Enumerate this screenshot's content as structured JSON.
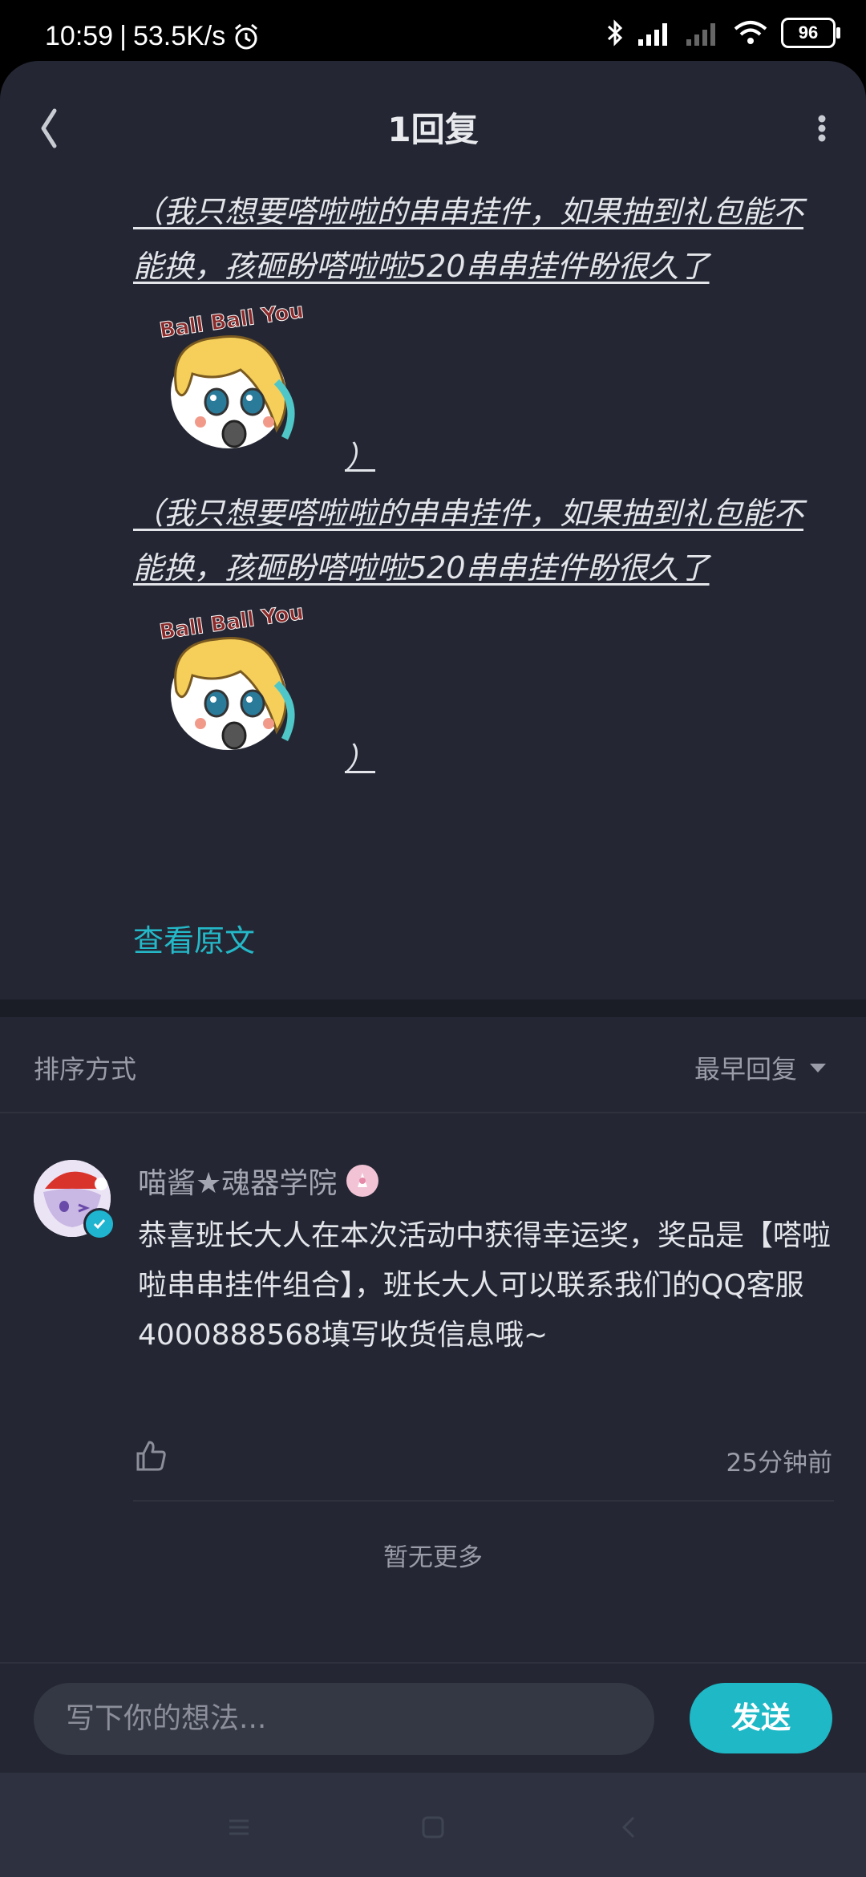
{
  "status_bar": {
    "time": "10:59",
    "speed": "53.5K/s",
    "battery": "96"
  },
  "header": {
    "title": "1回复"
  },
  "post": {
    "quote_1": "（我只想要嗒啦啦的串串挂件，如果抽到礼包能不能换，孩砸盼嗒啦啦520串串挂件盼很久了",
    "paren_1": "）",
    "quote_2": "（我只想要嗒啦啦的串串挂件，如果抽到礼包能不能换，孩砸盼嗒啦啦520串串挂件盼很久了",
    "paren_2": "）",
    "sticker_text": "Ball Ball You",
    "view_original": "查看原文"
  },
  "sort": {
    "label": "排序方式",
    "value": "最早回复"
  },
  "reply": {
    "name": "喵酱★魂器学院",
    "text": "恭喜班长大人在本次活动中获得幸运奖，奖品是【嗒啦啦串串挂件组合】，班长大人可以联系我们的QQ客服4000888568填写收货信息哦~",
    "time": "25分钟前"
  },
  "list_end": "暂无更多",
  "composer": {
    "placeholder": "写下你的想法...",
    "send_label": "发送"
  },
  "colors": {
    "background": "#242733",
    "accent": "#1eb8c6",
    "link": "#24b8c8"
  }
}
